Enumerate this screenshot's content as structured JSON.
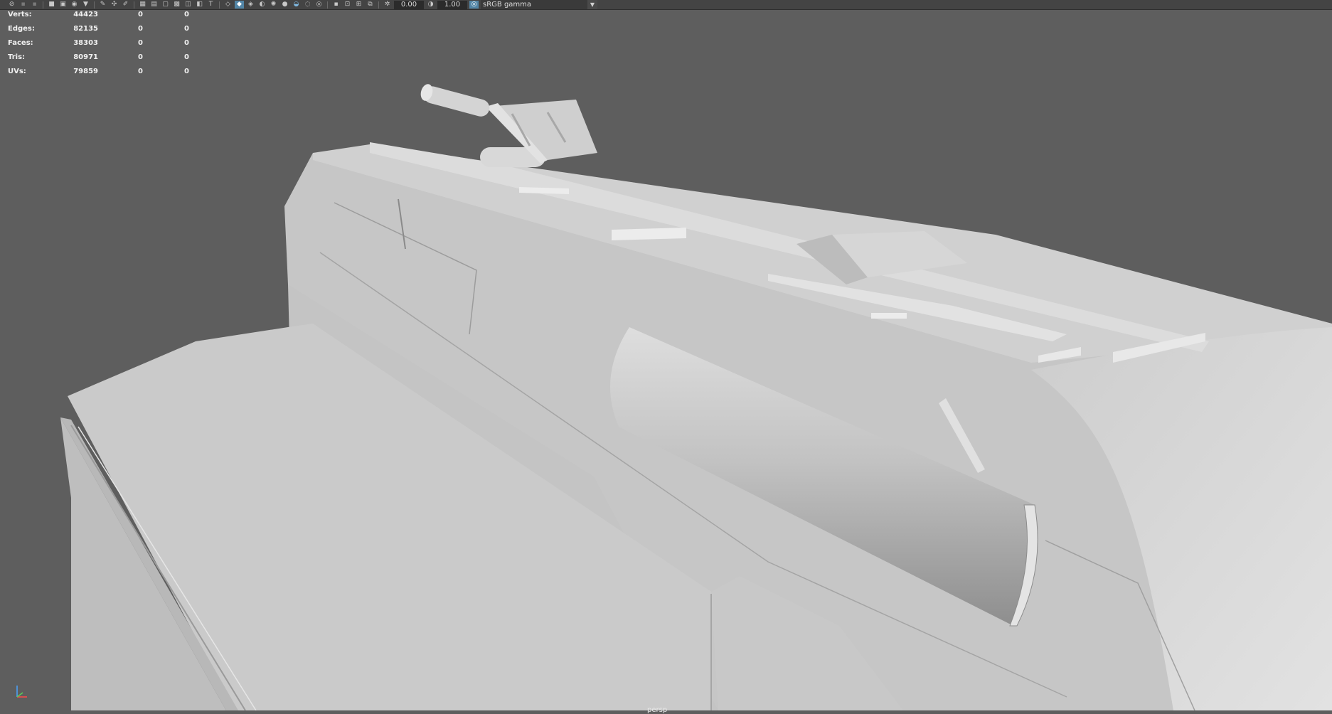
{
  "toolbar": {
    "icons": [
      "select-icon",
      "lasso-icon",
      "paint-icon",
      "camera-icon",
      "bookmark-icon",
      "image-plane-icon",
      "grid-icon",
      "film-gate-icon",
      "resolution-gate-icon",
      "safe-action-icon",
      "wireframe-icon",
      "smooth-shade-icon",
      "textured-icon",
      "lighting-icon",
      "shadows-icon",
      "isolate-icon",
      "xray-icon",
      "exposure-icon",
      "gamma-icon"
    ],
    "exposure_value": "0.00",
    "gamma_value": "1.00",
    "color_space": "sRGB gamma"
  },
  "hud": {
    "rows": [
      {
        "label": "Verts:",
        "v1": "44423",
        "v2": "0",
        "v3": "0"
      },
      {
        "label": "Edges:",
        "v1": "82135",
        "v2": "0",
        "v3": "0"
      },
      {
        "label": "Faces:",
        "v1": "38303",
        "v2": "0",
        "v3": "0"
      },
      {
        "label": "Tris:",
        "v1": "80971",
        "v2": "0",
        "v3": "0"
      },
      {
        "label": "UVs:",
        "v1": "79859",
        "v2": "0",
        "v3": "0"
      }
    ]
  },
  "viewport": {
    "camera": "persp",
    "background": "#5e5e5e",
    "model_color": "#c8c8c8"
  }
}
